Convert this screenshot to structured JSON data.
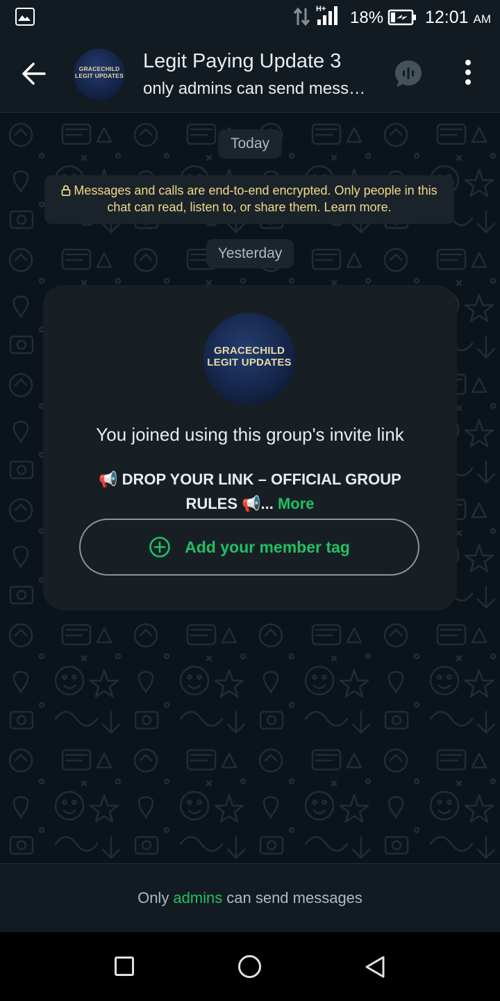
{
  "status_bar": {
    "network": "H+",
    "battery_percent": "18%",
    "time": "12:01",
    "time_suffix": "AM"
  },
  "header": {
    "avatar_text_line1": "GRACECHILD",
    "avatar_text_line2": "LEGIT UPDATES",
    "title": "Legit Paying Update 3",
    "subtitle": "only admins can send mess…"
  },
  "chat": {
    "date_today": "Today",
    "encryption_notice": "Messages and calls are end-to-end encrypted. Only people in this chat can read, listen to, or share them. Learn more.",
    "date_yesterday": "Yesterday",
    "card": {
      "avatar_text_line1": "GRACECHILD",
      "avatar_text_line2": "LEGIT UPDATES",
      "joined_text": "You joined using this group's invite link",
      "description": "📢 DROP YOUR LINK – OFFICIAL GROUP RULES 📢...",
      "more_label": "More",
      "tag_button_label": "Add your member tag"
    }
  },
  "footer": {
    "prefix": "Only",
    "link": "admins",
    "suffix": "can send messages"
  },
  "colors": {
    "accent": "#21c063",
    "header_bg": "#121b22",
    "chat_bg": "#0b141a",
    "notice_text": "#f2d98a"
  },
  "icons": {
    "back": "arrow-left-icon",
    "voice_chat": "voice-chat-icon",
    "menu": "more-vert-icon",
    "lock": "lock-icon",
    "add": "plus-circle-icon"
  }
}
